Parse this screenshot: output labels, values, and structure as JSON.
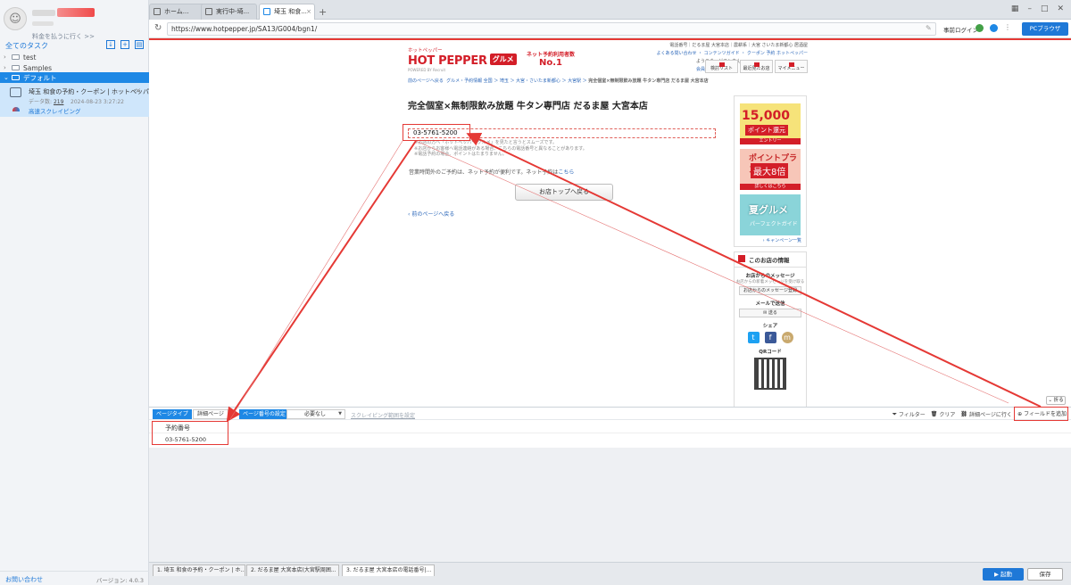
{
  "sidebar": {
    "upgrade_link": "料金を払うに行く >>",
    "all_tasks": "全てのタスク",
    "tree": [
      {
        "label": "test",
        "expanded": false
      },
      {
        "label": "Samples",
        "expanded": false
      },
      {
        "label": "デフォルト",
        "expanded": true
      }
    ],
    "task": {
      "title": "埼玉 和食の予約・クーポン | ホットペッパ...",
      "data_label": "データ数:",
      "data_count": "219",
      "date": "2024-08-23 3:27:22",
      "status": "高速スクレイピング"
    },
    "contact": "お問い合わせ",
    "version": "バージョン: 4.0.3"
  },
  "browser": {
    "tabs": [
      {
        "label": "ホーム..."
      },
      {
        "label": "実行中-埼..."
      },
      {
        "label": "埼玉 和食..."
      }
    ],
    "new_tab": "+",
    "url": "https://www.hotpepper.jp/SA13/G004/bgn1/",
    "login": "事前ログイン",
    "pc_browser": "PCブラウザ"
  },
  "page": {
    "brand_small": "ホットペッパー",
    "brand_name": "HOT PEPPER",
    "brand_gourmet": "グルメ",
    "brand_by": "POWERED BY Recruit",
    "no1_text": "ネット予約利用者数",
    "no1_big": "No.1",
    "header_links": "電話番号｜だるま屋 大宮本店｜農耕系｜大宮 さいたま新都心 居酒屋",
    "header_links2": "よくある問い合わせ ・ コンテンツガイド ・ クーポン 予約 ホットペッパー",
    "welcome": "ようこそ、ゲストさん",
    "register": "会員登録する（無料）",
    "nav": [
      "検討リスト",
      "最近見たお店",
      "マイメニュー"
    ],
    "breadcrumb_back": "前のページへ戻る",
    "breadcrumb": "グルメ・予約情報 全国 ＞ 埼玉 ＞ 大宮・さいたま新都心 ＞ 大宮駅 ＞",
    "breadcrumb_current": "完全個室×無制限飲み放題 牛タン専門店 だるま屋 大宮本店",
    "title": "完全個室×無制限飲み放題 牛タン専門店 だるま屋 大宮本店",
    "phone": "03-5761-5200",
    "phone_note1": "※お店の方へ「ホットペッパー グルメ」を見たと言うとスムーズです。",
    "phone_note2": "※お店からお客様へ電話連絡がある場合、こちらの電話番号と異なることがあります。",
    "phone_note3": "※電話予約の場合、ポイントはたまりません。",
    "hours_note": "営業時間外のご予約は、ネット予約が便利です。ネット予約は",
    "hours_link": "こちら",
    "shop_top_button": "お店トップへ戻る",
    "back_link": "前のページへ戻る",
    "ads": [
      {
        "big": "15,000",
        "sub": "ポイント還元",
        "strip": "エントリー"
      },
      {
        "big": "ポイントプラスで",
        "sub": "最大8倍",
        "strip": "詳しくはこちら"
      },
      {
        "big": "夏グルメ",
        "sub": "パーフェクトガイド",
        "strip": ""
      }
    ],
    "campaign_link": "キャンペーン一覧",
    "info_header": "このお店の情報",
    "message_title": "お店からのメッセージ",
    "message_sub": "お店からの新着メッセージを受け取る",
    "message_button": "お店からのメッセージ登録",
    "mail_title": "メールで送信",
    "mail_button": "送る",
    "share_title": "シェア",
    "qr_title": "QRコード",
    "collapse": "折る"
  },
  "config": {
    "page_type_label": "ページタイプ",
    "page_type_value": "詳細ページ",
    "page_num_label": "ページ番号の設定",
    "page_num_value": "必要なし",
    "scrape_range": "スクレイピング範囲を設定",
    "filter": "フィルター",
    "clear": "クリア",
    "goto_detail": "詳細ページに行く",
    "add_field": "フィールドを追加"
  },
  "table": {
    "columns": [
      "予約番号"
    ],
    "rows": [
      [
        "03-5761-5200"
      ]
    ]
  },
  "bottom_tabs": [
    {
      "label": "1. 埼玉 和食の予約・クーポン | ホ..."
    },
    {
      "label": "2. だるま屋 大宮本店(大宮駅周囲..."
    },
    {
      "label": "3. だるま屋 大宮本店の電話番号|..."
    }
  ],
  "run_button": "起動",
  "save_button": "保存",
  "colors": {
    "accent": "#1e88e5",
    "highlight": "#e53935",
    "brand": "#d31e28"
  }
}
